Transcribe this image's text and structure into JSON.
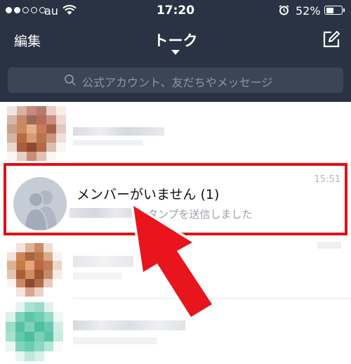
{
  "status_bar": {
    "carrier": "au",
    "time": "17:20",
    "battery_percent": "52%",
    "battery_level": 0.52,
    "signal_bars": 2
  },
  "header": {
    "edit_label": "編集",
    "title": "トーク",
    "compose_icon": "compose-icon"
  },
  "search": {
    "placeholder": "公式アカウント、友だちやメッセージ"
  },
  "chats": [
    {
      "name": "",
      "preview": "",
      "time": ""
    },
    {
      "name": "メンバーがいません (1)",
      "preview": "スタンプを送信しました",
      "time": "15:51",
      "highlighted": true
    },
    {
      "name": "",
      "preview": "",
      "time": ""
    },
    {
      "name": "",
      "preview": "",
      "time": ""
    }
  ],
  "colors": {
    "header_bg": "#2a3343",
    "search_bg": "#3b4555",
    "highlight": "#e01017",
    "arrow": "#e8151c"
  }
}
